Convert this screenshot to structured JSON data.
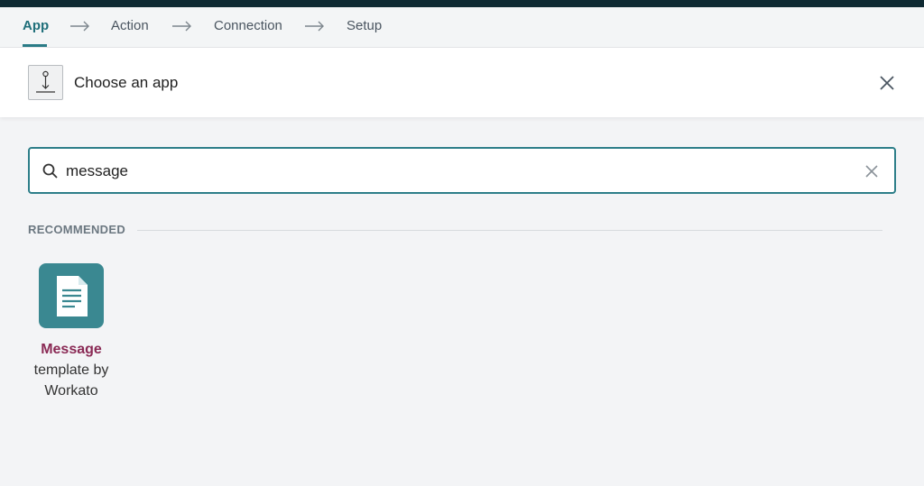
{
  "wizard": {
    "steps": [
      {
        "label": "App",
        "active": true
      },
      {
        "label": "Action",
        "active": false
      },
      {
        "label": "Connection",
        "active": false
      },
      {
        "label": "Setup",
        "active": false
      }
    ]
  },
  "header": {
    "title": "Choose an app",
    "icon": "app-placeholder-icon",
    "close_icon": "close-icon"
  },
  "search": {
    "value": "message",
    "search_icon": "search-icon",
    "clear_icon": "clear-icon"
  },
  "section": {
    "label": "RECOMMENDED"
  },
  "apps": [
    {
      "name_highlight": "Message",
      "name_rest": "template by Workato",
      "icon": "document-icon",
      "icon_color": "#3a8891"
    }
  ],
  "colors": {
    "accent": "#2d7e89",
    "highlight": "#8a2a55",
    "topbar": "#0f2a33"
  }
}
